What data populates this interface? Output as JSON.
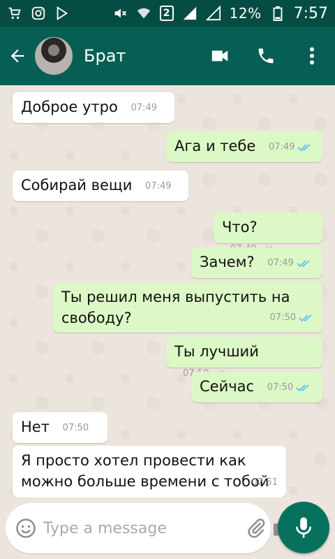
{
  "status_bar": {
    "battery_percent": "12%",
    "time": "7:57",
    "sim": "2"
  },
  "header": {
    "contact_name": "Брат"
  },
  "messages": [
    {
      "side": "in",
      "text": "Доброе утро",
      "time": "07:49"
    },
    {
      "side": "out",
      "text": "Ага и тебе",
      "time": "07:49",
      "read": true
    },
    {
      "side": "in",
      "text": "Собирай вещи",
      "time": "07:49"
    },
    {
      "side": "out",
      "text": "Что?",
      "time": "07:49",
      "read": true
    },
    {
      "side": "out",
      "text": "Зачем?",
      "time": "07:49",
      "read": true
    },
    {
      "side": "out",
      "text": "Ты решил меня выпустить на свободу?",
      "time": "07:50",
      "read": true
    },
    {
      "side": "out",
      "text": "Ты лучший",
      "time": "07:50",
      "read": true
    },
    {
      "side": "out",
      "text": "Сейчас",
      "time": "07:50",
      "read": true
    },
    {
      "side": "in",
      "text": "Нет",
      "time": "07:50"
    },
    {
      "side": "in",
      "text": "Я просто хотел провести как можно больше времени с тобой",
      "time": "07:51"
    }
  ],
  "composer": {
    "placeholder": "Type a message",
    "value": ""
  },
  "colors": {
    "status_bar": "#054d44",
    "header": "#075e54",
    "outgoing_bubble": "#dcf8c6",
    "incoming_bubble": "#ffffff",
    "read_ticks": "#4fc3f7",
    "mic_button": "#07715f"
  }
}
